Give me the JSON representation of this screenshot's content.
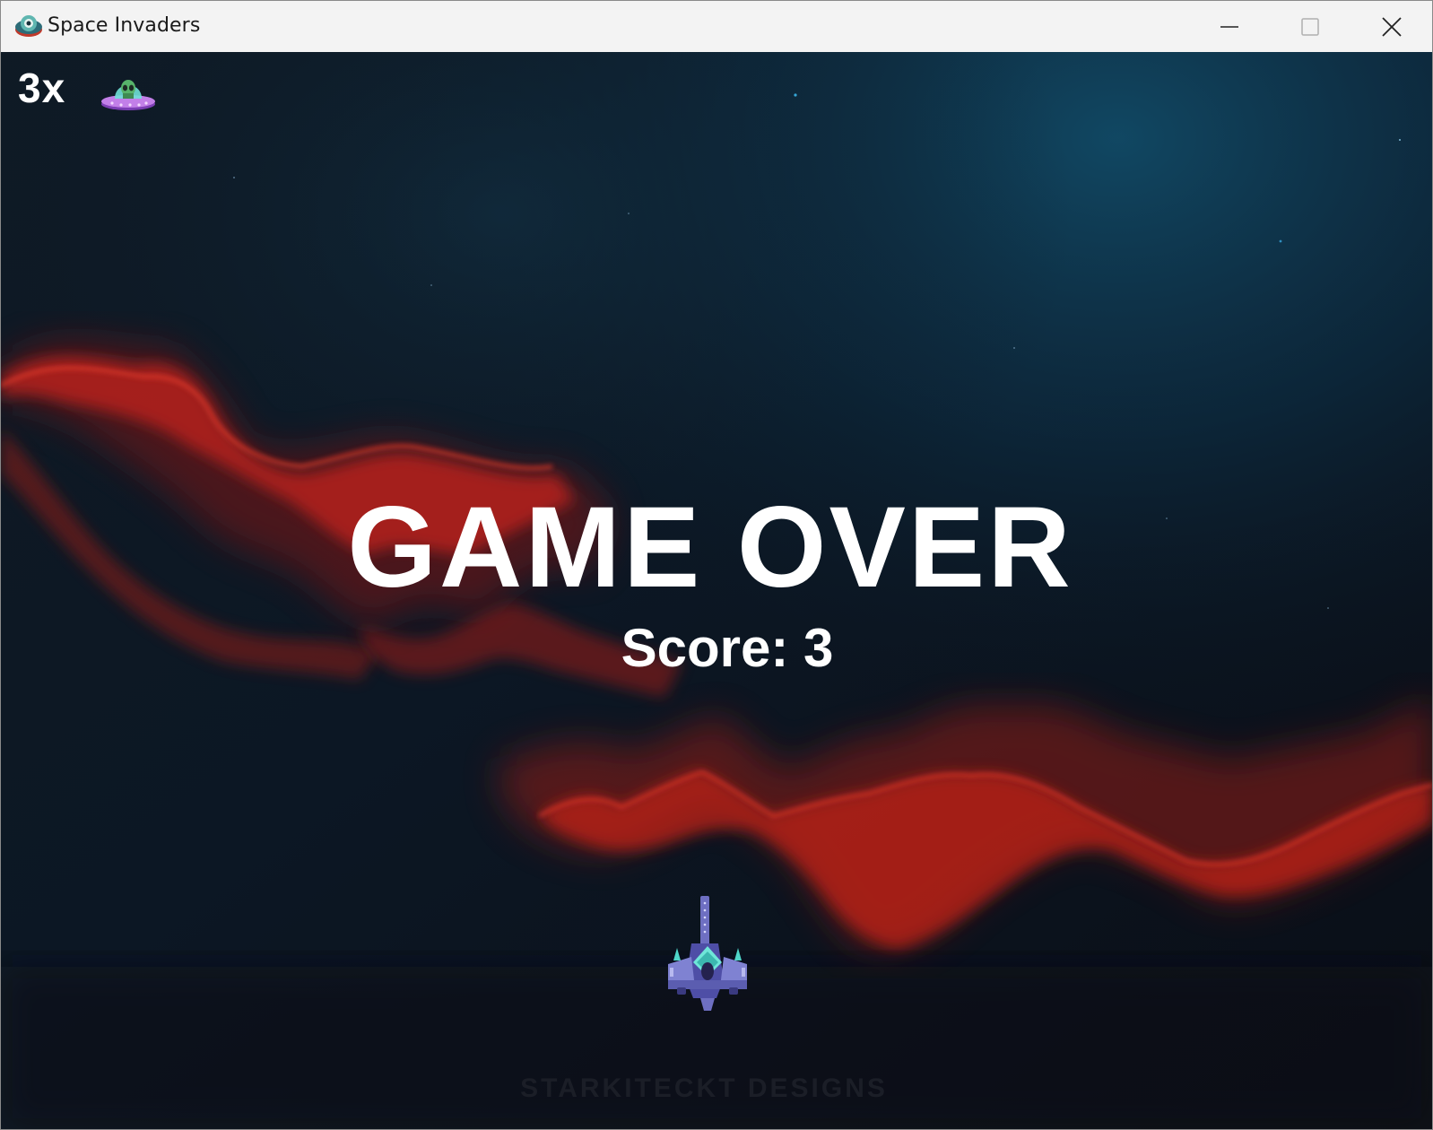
{
  "window": {
    "title": "Space Invaders",
    "icon": "alien-eye-icon"
  },
  "controls": {
    "minimize_icon": "minimize-icon",
    "maximize_icon": "maximize-icon",
    "close_icon": "close-icon"
  },
  "hud": {
    "lives_text": "3x",
    "lives_icon": "ufo-alien-icon"
  },
  "game": {
    "status_text": "GAME OVER",
    "score_text": "Score: 3",
    "player_sprite": "player-spaceship",
    "background": "red-nebula-space",
    "watermark": "STARKITECKT DESIGNS"
  },
  "colors": {
    "text": "#ffffff",
    "space_dark": "#0b0f18",
    "nebula_red": "#c0231c",
    "space_blue": "#0e3a52"
  }
}
